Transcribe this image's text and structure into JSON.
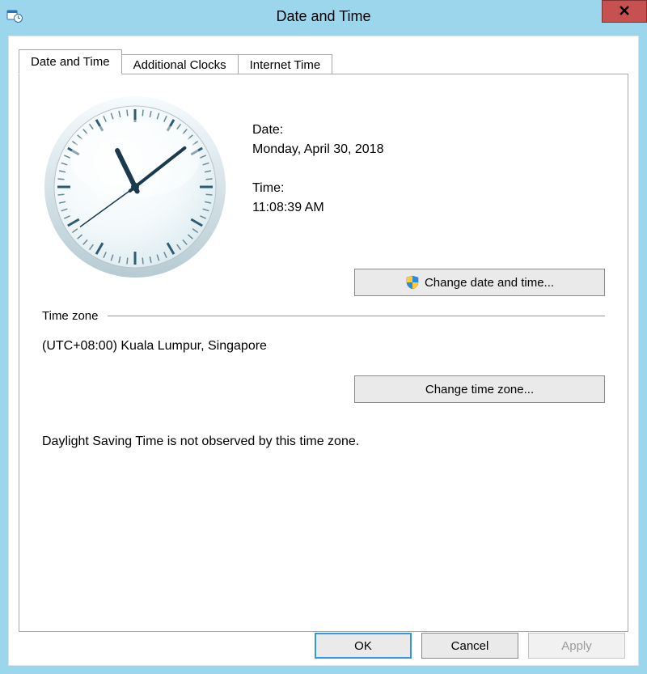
{
  "window": {
    "title": "Date and Time"
  },
  "tabs": {
    "t0": "Date and Time",
    "t1": "Additional Clocks",
    "t2": "Internet Time"
  },
  "main": {
    "date_label": "Date:",
    "date_value": "Monday, April 30, 2018",
    "time_label": "Time:",
    "time_value": "11:08:39 AM",
    "change_dt_btn": "Change date and time...",
    "tz_header": "Time zone",
    "tz_value": "(UTC+08:00) Kuala Lumpur, Singapore",
    "change_tz_btn": "Change time zone...",
    "dst_note": "Daylight Saving Time is not observed by this time zone."
  },
  "footer": {
    "ok": "OK",
    "cancel": "Cancel",
    "apply": "Apply"
  },
  "clock": {
    "hour": 11,
    "minute": 8,
    "second": 39
  }
}
